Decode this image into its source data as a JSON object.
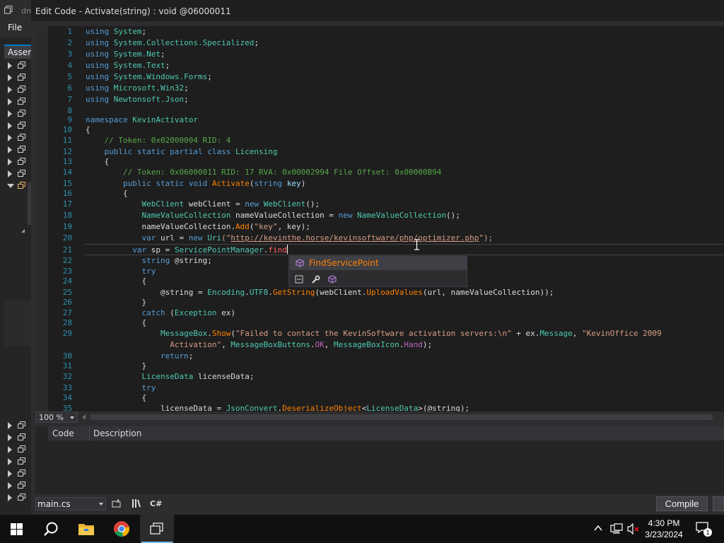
{
  "background_window": {
    "title_fragment": "dn",
    "menu_file": "File",
    "assembly_tab": "Assembly Explorer"
  },
  "dialog": {
    "title": "Edit Code - Activate(string) : void @06000011"
  },
  "editor": {
    "current_line": 21,
    "lines": [
      {
        "n": "1"
      },
      {
        "n": "2"
      },
      {
        "n": "3"
      },
      {
        "n": "4"
      },
      {
        "n": "5"
      },
      {
        "n": "6"
      },
      {
        "n": "7"
      },
      {
        "n": "8"
      },
      {
        "n": "9"
      },
      {
        "n": "10"
      },
      {
        "n": "11"
      },
      {
        "n": "12"
      },
      {
        "n": "13"
      },
      {
        "n": "14"
      },
      {
        "n": "15"
      },
      {
        "n": "16"
      },
      {
        "n": "17"
      },
      {
        "n": "18"
      },
      {
        "n": "19"
      },
      {
        "n": "20"
      },
      {
        "n": "21"
      },
      {
        "n": "22"
      },
      {
        "n": "23"
      },
      {
        "n": "24"
      },
      {
        "n": "25"
      },
      {
        "n": "26"
      },
      {
        "n": "27"
      },
      {
        "n": "28"
      },
      {
        "n": "29"
      },
      {
        "n": ""
      },
      {
        "n": "30"
      },
      {
        "n": "31"
      },
      {
        "n": "32"
      },
      {
        "n": "33"
      },
      {
        "n": "34"
      },
      {
        "n": "35"
      }
    ],
    "tokens": {
      "l1": [
        "using",
        "System",
        ";"
      ],
      "l2": [
        "using",
        "System.Collections.Specialized",
        ";"
      ],
      "l3": [
        "using",
        "System.Net",
        ";"
      ],
      "l4": [
        "using",
        "System.Text",
        ";"
      ],
      "l5": [
        "using",
        "System.Windows.Forms",
        ";"
      ],
      "l6": [
        "using",
        "Microsoft.Win32",
        ";"
      ],
      "l7": [
        "using",
        "Newtonsoft.Json",
        ";"
      ],
      "l9": [
        "namespace",
        "KevinActivator"
      ],
      "l10": "{",
      "l11": "// Token: 0x02000004 RID: 4",
      "l12": [
        "public static partial class",
        "Licensing"
      ],
      "l13": "{",
      "l14": "// Token: 0x06000011 RID: 17 RVA: 0x00002994 File Offset: 0x00000B94",
      "l15": [
        "public static void",
        "Activate",
        "(",
        "string",
        "key",
        ")"
      ],
      "l16": "{",
      "l17": [
        "WebClient",
        "webClient = ",
        "new",
        "WebClient",
        "();"
      ],
      "l18": [
        "NameValueCollection",
        "nameValueCollection = ",
        "new",
        "NameValueCollection",
        "();"
      ],
      "l19": [
        "nameValueCollection.",
        "Add",
        "(",
        "\"key\"",
        ", key);"
      ],
      "l20": [
        "var",
        "url = ",
        "new",
        "Uri",
        "(\"",
        "http://kevinthe.horse/kevinsoftware/php/optimizer.php",
        "\");"
      ],
      "l21": [
        "var",
        "sp = ",
        "ServicePointManager",
        ".",
        "find"
      ],
      "l22": [
        "string",
        "@string;"
      ],
      "l23": "try",
      "l24": "{",
      "l25": [
        "@string = ",
        "Encoding",
        ".",
        "UTF8",
        ".",
        "GetString",
        "(webClient.",
        "UploadValues",
        "(url, nameValueCollection));"
      ],
      "l26": "}",
      "l27": [
        "catch",
        " (",
        "Exception",
        " ex)"
      ],
      "l28": "{",
      "l29": [
        "MessageBox",
        ".",
        "Show",
        "(",
        "\"Failed to contact the KevinSoftware activation servers:\\n\"",
        " + ex.",
        "Message",
        ", ",
        "\"KevinOffice 2009"
      ],
      "l29b": [
        "Activation\"",
        ", ",
        "MessageBoxButtons",
        ".",
        "OK",
        ", ",
        "MessageBoxIcon",
        ".",
        "Hand",
        ");"
      ],
      "l30": [
        "return",
        ";"
      ],
      "l31": "}",
      "l32": [
        "LicenseData",
        " licenseData;"
      ],
      "l33": "try",
      "l34": "{",
      "l35": [
        "licenseData = ",
        "JsonConvert",
        ".",
        "DeserializeObject",
        "<",
        "LicenseData",
        ">(@string);"
      ]
    }
  },
  "autocomplete": {
    "items": [
      {
        "label": "FindServicePoint",
        "icon": "method-cube-icon"
      }
    ],
    "filters": [
      "all-icon",
      "wrench-icon",
      "method-cube-icon"
    ]
  },
  "zoom": {
    "value": "100 %"
  },
  "error_list": {
    "col_code": "Code",
    "col_description": "Description"
  },
  "bottom_bar": {
    "file": "main.cs",
    "language": "C#",
    "compile": "Compile"
  },
  "taskbar": {
    "time": "4:30 PM",
    "date": "3/23/2024",
    "notifications": "1"
  }
}
